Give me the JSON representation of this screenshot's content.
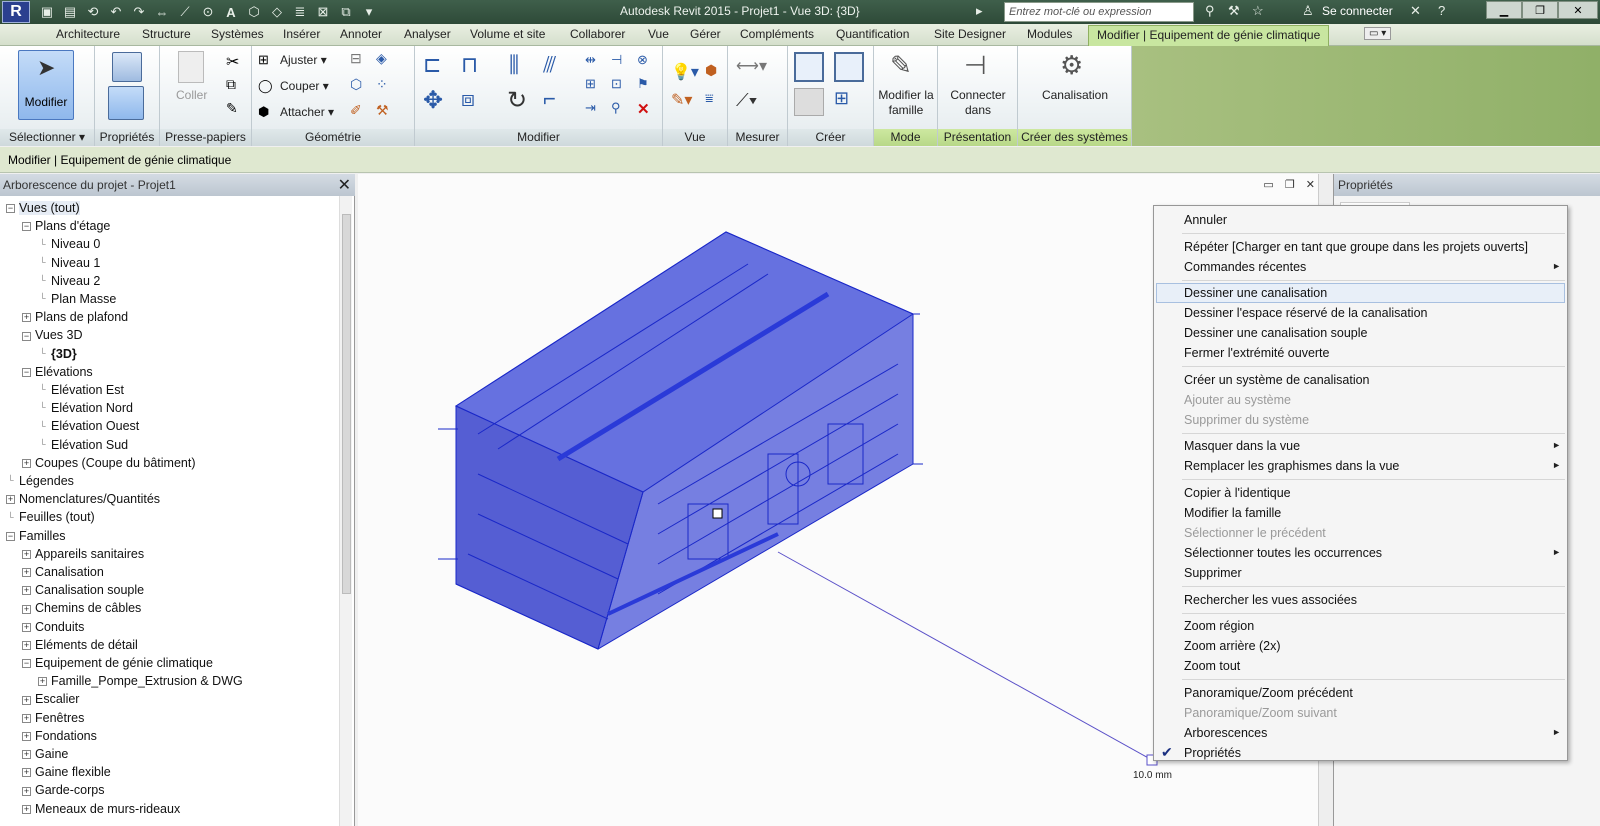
{
  "app": {
    "title": "Autodesk Revit 2015  -   Projet1 - Vue 3D: {3D}",
    "menu_logo": "R",
    "search_placeholder": "Entrez mot-clé ou expression",
    "sign_in": "Se connecter"
  },
  "tabs": [
    "Architecture",
    "Structure",
    "Systèmes",
    "Insérer",
    "Annoter",
    "Analyser",
    "Volume et site",
    "Collaborer",
    "Vue",
    "Gérer",
    "Compléments",
    "Quantification",
    "Site Designer",
    "Modules",
    "Modifier | Equipement de génie climatique"
  ],
  "ribbon": {
    "select_label": "Modifier",
    "select_panel": "Sélectionner",
    "properties_panel": "Propriétés",
    "clipboard": {
      "paste": "Coller",
      "panel": "Presse-papiers"
    },
    "geometry": {
      "adjust": "Ajuster",
      "cut": "Couper",
      "join": "Attacher",
      "panel": "Géométrie"
    },
    "modify_panel": "Modifier",
    "view_panel": "Vue",
    "measure_panel": "Mesurer",
    "create_panel": "Créer",
    "mode": {
      "button": "Modifier la famille",
      "panel": "Mode"
    },
    "presentation": {
      "button": "Connecter dans",
      "panel": "Présentation"
    },
    "systems": {
      "button": "Canalisation",
      "panel": "Créer des systèmes"
    }
  },
  "context_bar": "Modifier | Equipement de génie climatique",
  "browser": {
    "title": "Arborescence du projet - Projet1",
    "items": [
      {
        "label": "Vues (tout)",
        "exp": "−",
        "level": 0
      },
      {
        "label": "Plans d'étage",
        "exp": "−",
        "level": 1
      },
      {
        "label": "Niveau 0",
        "exp": "",
        "level": 2
      },
      {
        "label": "Niveau 1",
        "exp": "",
        "level": 2
      },
      {
        "label": "Niveau 2",
        "exp": "",
        "level": 2
      },
      {
        "label": "Plan Masse",
        "exp": "",
        "level": 2
      },
      {
        "label": "Plans de plafond",
        "exp": "+",
        "level": 1
      },
      {
        "label": "Vues 3D",
        "exp": "−",
        "level": 1
      },
      {
        "label": "{3D}",
        "exp": "",
        "level": 2
      },
      {
        "label": "Elévations",
        "exp": "−",
        "level": 1
      },
      {
        "label": "Elévation Est",
        "exp": "",
        "level": 2
      },
      {
        "label": "Elévation Nord",
        "exp": "",
        "level": 2
      },
      {
        "label": "Elévation Ouest",
        "exp": "",
        "level": 2
      },
      {
        "label": "Elévation Sud",
        "exp": "",
        "level": 2
      },
      {
        "label": "Coupes (Coupe du bâtiment)",
        "exp": "+",
        "level": 1
      },
      {
        "label": "Légendes",
        "exp": "",
        "level": 0
      },
      {
        "label": "Nomenclatures/Quantités",
        "exp": "+",
        "level": 0
      },
      {
        "label": "Feuilles (tout)",
        "exp": "",
        "level": 0
      },
      {
        "label": "Familles",
        "exp": "−",
        "level": 0
      },
      {
        "label": "Appareils sanitaires",
        "exp": "+",
        "level": 1
      },
      {
        "label": "Canalisation",
        "exp": "+",
        "level": 1
      },
      {
        "label": "Canalisation souple",
        "exp": "+",
        "level": 1
      },
      {
        "label": "Chemins de câbles",
        "exp": "+",
        "level": 1
      },
      {
        "label": "Conduits",
        "exp": "+",
        "level": 1
      },
      {
        "label": "Eléments de détail",
        "exp": "+",
        "level": 1
      },
      {
        "label": "Equipement de génie climatique",
        "exp": "−",
        "level": 1
      },
      {
        "label": "Famille_Pompe_Extrusion & DWG",
        "exp": "+",
        "level": 2
      },
      {
        "label": "Escalier",
        "exp": "+",
        "level": 1
      },
      {
        "label": "Fenêtres",
        "exp": "+",
        "level": 1
      },
      {
        "label": "Fondations",
        "exp": "+",
        "level": 1
      },
      {
        "label": "Gaine",
        "exp": "+",
        "level": 1
      },
      {
        "label": "Gaine flexible",
        "exp": "+",
        "level": 1
      },
      {
        "label": "Garde-corps",
        "exp": "+",
        "level": 1
      },
      {
        "label": "Meneaux de murs-rideaux",
        "exp": "+",
        "level": 1
      }
    ]
  },
  "viewport": {
    "dimension": "10.0 mm"
  },
  "properties": {
    "title": "Propriétés"
  },
  "context_menu": [
    {
      "label": "Annuler"
    },
    {
      "sep": true
    },
    {
      "label": "Répéter [Charger en tant que groupe dans les projets ouverts]"
    },
    {
      "label": "Commandes récentes",
      "sub": true
    },
    {
      "sep": true
    },
    {
      "label": "Dessiner une canalisation",
      "hl": true
    },
    {
      "label": "Dessiner l'espace réservé de la canalisation"
    },
    {
      "label": "Dessiner une canalisation souple"
    },
    {
      "label": "Fermer l'extrémité ouverte"
    },
    {
      "sep": true
    },
    {
      "label": "Créer un système de canalisation"
    },
    {
      "label": "Ajouter au système",
      "dis": true
    },
    {
      "label": "Supprimer du système",
      "dis": true
    },
    {
      "sep": true
    },
    {
      "label": "Masquer dans la vue",
      "sub": true
    },
    {
      "label": "Remplacer les graphismes dans la vue",
      "sub": true
    },
    {
      "sep": true
    },
    {
      "label": "Copier à l'identique"
    },
    {
      "label": "Modifier la famille"
    },
    {
      "label": "Sélectionner le précédent",
      "dis": true
    },
    {
      "label": "Sélectionner toutes les occurrences",
      "sub": true
    },
    {
      "label": "Supprimer"
    },
    {
      "sep": true
    },
    {
      "label": "Rechercher les vues associées"
    },
    {
      "sep": true
    },
    {
      "label": "Zoom région"
    },
    {
      "label": "Zoom arrière (2x)"
    },
    {
      "label": "Zoom tout"
    },
    {
      "sep": true
    },
    {
      "label": "Panoramique/Zoom précédent"
    },
    {
      "label": "Panoramique/Zoom suivant",
      "dis": true
    },
    {
      "label": "Arborescences",
      "sub": true
    },
    {
      "label": "Propriétés",
      "check": true
    }
  ]
}
